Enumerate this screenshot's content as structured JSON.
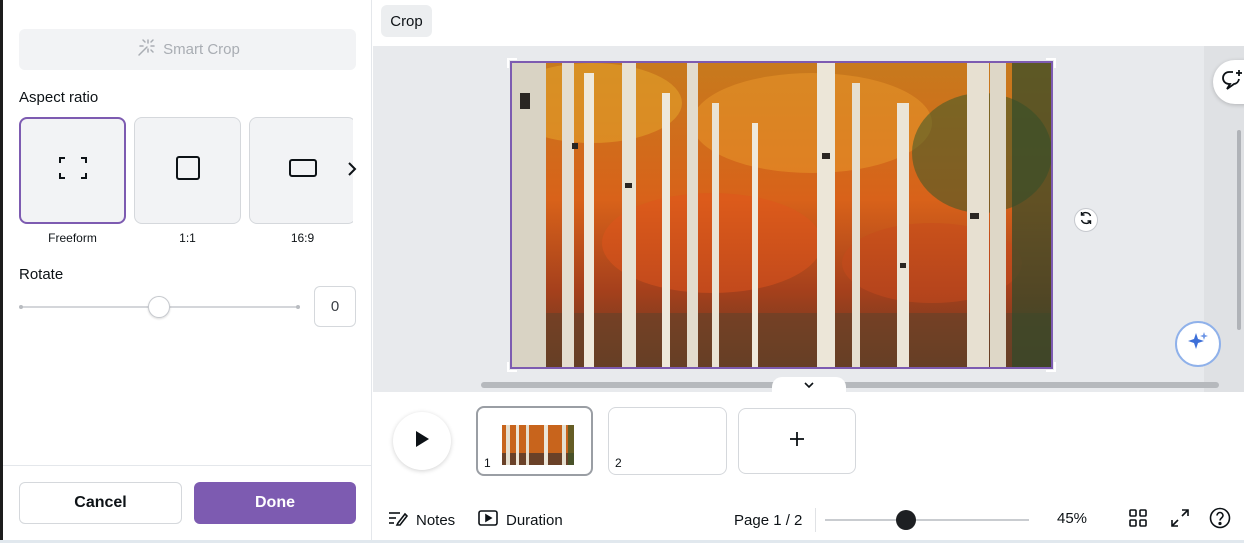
{
  "panel": {
    "smart_crop_label": "Smart Crop",
    "aspect_ratio_label": "Aspect ratio",
    "ratios": [
      {
        "label": "Freeform",
        "selected": true
      },
      {
        "label": "1:1",
        "selected": false
      },
      {
        "label": "16:9",
        "selected": false
      }
    ],
    "rotate_label": "Rotate",
    "rotate_value": "0",
    "cancel_label": "Cancel",
    "done_label": "Done"
  },
  "topbar": {
    "crop_label": "Crop"
  },
  "pages": [
    {
      "number": "1",
      "selected": true
    },
    {
      "number": "2",
      "selected": false
    }
  ],
  "footer": {
    "notes_label": "Notes",
    "duration_label": "Duration",
    "page_indicator": "Page 1 / 2",
    "zoom": "45%"
  },
  "colors": {
    "accent": "#7d5bb1",
    "canvas_bg": "#e8eaed"
  },
  "icons": [
    "magic-wand-icon",
    "freeform-icon",
    "square-icon",
    "landscape-icon",
    "chevron-right-icon",
    "rotate-icon",
    "comment-add-icon",
    "sparkle-icon",
    "chevron-down-icon",
    "play-icon",
    "plus-icon",
    "notes-icon",
    "duration-icon",
    "grid-view-icon",
    "fullscreen-icon",
    "help-icon"
  ]
}
